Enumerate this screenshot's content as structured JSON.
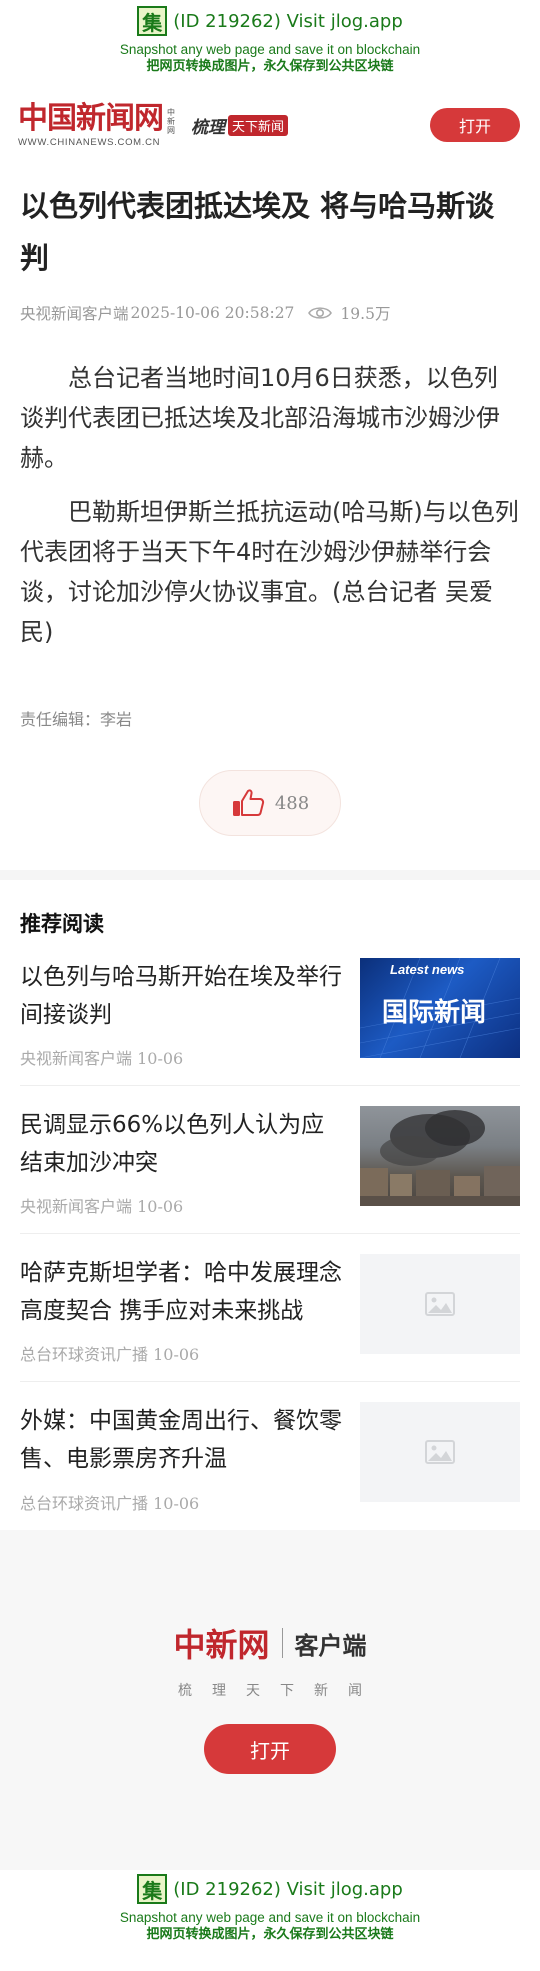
{
  "banner": {
    "badge": "集",
    "main": "(ID 219262) Visit jlog.app",
    "sub_en": "Snapshot any web page and save it on blockchain",
    "sub_cn": "把网页转换成图片，永久保存到公共区块链"
  },
  "header": {
    "logo_cn": "中国新闻网",
    "logo_tiny": "中新网",
    "logo_url": "WWW.CHINANEWS.COM.CN",
    "slogan_a": "梳理",
    "slogan_b": "天下新闻",
    "open_label": "打开"
  },
  "article": {
    "title": "以色列代表团抵达埃及 将与哈马斯谈判",
    "source": "央视新闻客户端",
    "datetime": "2025-10-06 20:58:27",
    "views": "19.5万",
    "paragraphs": [
      "总台记者当地时间10月6日获悉，以色列谈判代表团已抵达埃及北部沿海城市沙姆沙伊赫。",
      "巴勒斯坦伊斯兰抵抗运动(哈马斯)与以色列代表团将于当天下午4时在沙姆沙伊赫举行会谈，讨论加沙停火协议事宜。(总台记者 吴爱民)"
    ],
    "editor": "责任编辑：李岩",
    "likes": "488"
  },
  "recommended": {
    "heading": "推荐阅读",
    "items": [
      {
        "headline": "以色列与哈马斯开始在埃及举行间接谈判",
        "source": "央视新闻客户端 10-06",
        "thumb_text": "国际新闻",
        "thumb_small": "Latest news"
      },
      {
        "headline": "民调显示66%以色列人认为应结束加沙冲突",
        "source": "央视新闻客户端 10-06"
      },
      {
        "headline": "哈萨克斯坦学者：哈中发展理念高度契合 携手应对未来挑战",
        "source": "总台环球资讯广播 10-06"
      },
      {
        "headline": "外媒：中国黄金周出行、餐饮零售、电影票房齐升温",
        "source": "总台环球资讯广播 10-06"
      }
    ]
  },
  "promo": {
    "logo_cn": "中新网",
    "app_label": "客户端",
    "slogan": "梳理天下新闻",
    "open_label": "打开"
  },
  "colors": {
    "brand_red": "#c0272d",
    "button_red": "#d6393a",
    "jlog_green": "#1a7a1a"
  }
}
